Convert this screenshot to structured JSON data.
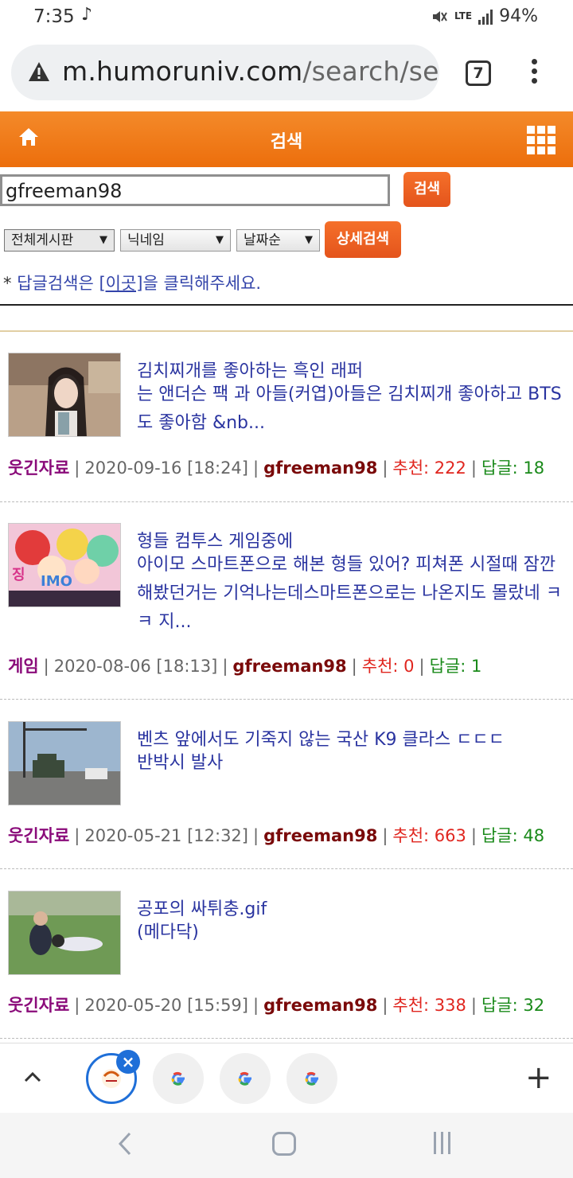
{
  "status": {
    "time": "7:35",
    "note_glyph": "♪",
    "network": "LTE",
    "battery": "94%"
  },
  "browser": {
    "url_host": "m.humoruniv.com",
    "url_path": "/search/sea",
    "tab_count": "7"
  },
  "nav": {
    "title": "검색"
  },
  "search": {
    "query": "gfreeman98",
    "button": "검색"
  },
  "filters": {
    "board": "전체게시판",
    "field": "닉네임",
    "sort": "날짜순",
    "detail_button": "상세검색"
  },
  "notice": {
    "prefix": "* ",
    "before": "답글검색은 ",
    "link": "[이곳]",
    "after": "을 클릭해주세요."
  },
  "posts": [
    {
      "title": "김치찌개를 좋아하는 흑인 래퍼",
      "excerpt": "  는 앤더슨 팩    과 아들(커엽)아들은 김치찌개 좋아하고 BTS도 좋아함 &nb...",
      "category": "웃긴자료",
      "date": "2020-09-16 [18:24]",
      "author": "gfreeman98",
      "recommend_label": "추천:",
      "recommend": "222",
      "reply_label": "답글:",
      "replies": "18"
    },
    {
      "title": "형들 컴투스 게임중에",
      "excerpt": " 아이모 스마트폰으로 해본 형들 있어? 피쳐폰 시절때 잠깐 해봤던거는 기억나는데스마트폰으로는 나온지도 몰랐네 ㅋㅋ 지...",
      "category": "게임",
      "date": "2020-08-06 [18:13]",
      "author": "gfreeman98",
      "recommend_label": "추천:",
      "recommend": "0",
      "reply_label": "답글:",
      "replies": "1"
    },
    {
      "title": "벤츠 앞에서도 기죽지 않는 국산 K9 클라스 ㄷㄷㄷ",
      "excerpt": " 반박시 발사",
      "category": "웃긴자료",
      "date": "2020-05-21 [12:32]",
      "author": "gfreeman98",
      "recommend_label": "추천:",
      "recommend": "663",
      "reply_label": "답글:",
      "replies": "48"
    },
    {
      "title": "공포의 싸튀충.gif",
      "excerpt": " (메다닥)",
      "category": "웃긴자료",
      "date": "2020-05-20 [15:59]",
      "author": "gfreeman98",
      "recommend_label": "추천:",
      "recommend": "338",
      "reply_label": "답글:",
      "replies": "32"
    }
  ],
  "colors": {
    "accent_orange": "#ec6e0c",
    "link_blue": "#2a34a0",
    "category_purple": "#8a0b7a",
    "author_red": "#7a0a0a",
    "recommend_red": "#e0261f",
    "reply_green": "#1a8a1a",
    "tab_blue": "#1f6fd8"
  },
  "icons": [
    "warning-icon",
    "home-icon",
    "apps-grid-icon",
    "google-icon",
    "chevron-up-icon",
    "plus-icon",
    "close-icon",
    "back-icon"
  ]
}
